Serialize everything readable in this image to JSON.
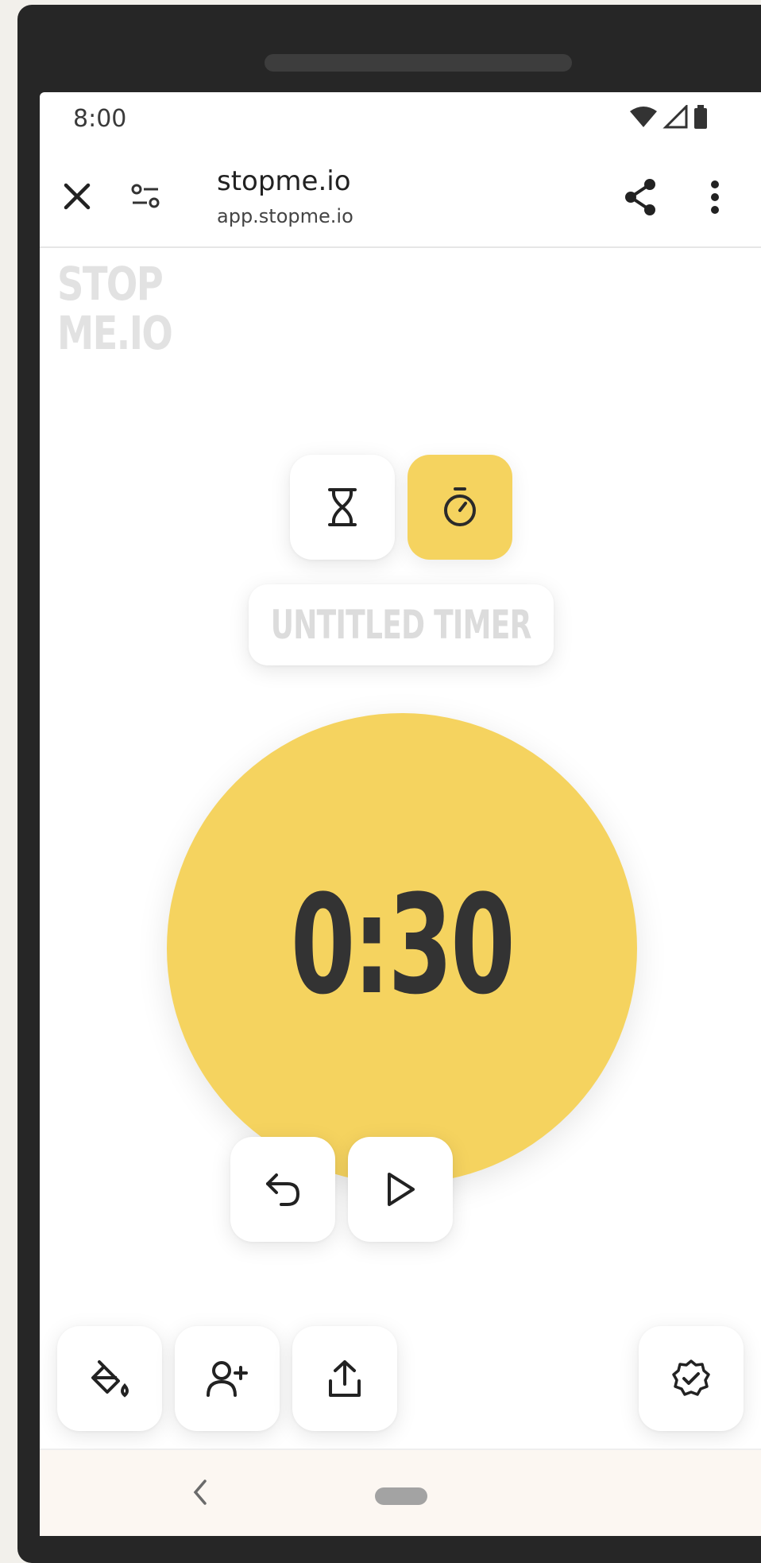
{
  "status": {
    "time": "8:00",
    "icons": [
      "wifi-icon",
      "cellular-signal-icon",
      "battery-icon"
    ]
  },
  "browser": {
    "page_title": "stopme.io",
    "url": "app.stopme.io",
    "icons": [
      "close-icon",
      "site-settings-icon",
      "share-icon",
      "more-vert-icon"
    ]
  },
  "app": {
    "logo_line1": "STOP",
    "logo_line2": "ME.IO",
    "modes": [
      {
        "name": "countdown",
        "icon": "hourglass-icon",
        "active": false
      },
      {
        "name": "stopwatch",
        "icon": "stopwatch-icon",
        "active": true
      }
    ],
    "timer_title_placeholder": "UNTITLED TIMER",
    "timer_display": "0:30",
    "controls": [
      "reset-icon",
      "play-icon"
    ],
    "bottom_actions": [
      "paint-bucket-icon",
      "add-user-icon",
      "upload-icon",
      "badge-check-icon"
    ]
  },
  "colors": {
    "accent": "#f5d35f",
    "frame": "#262626",
    "page_bg": "#f2f0eb",
    "placeholder_text": "#dcdcdc",
    "timer_text": "#333333"
  }
}
